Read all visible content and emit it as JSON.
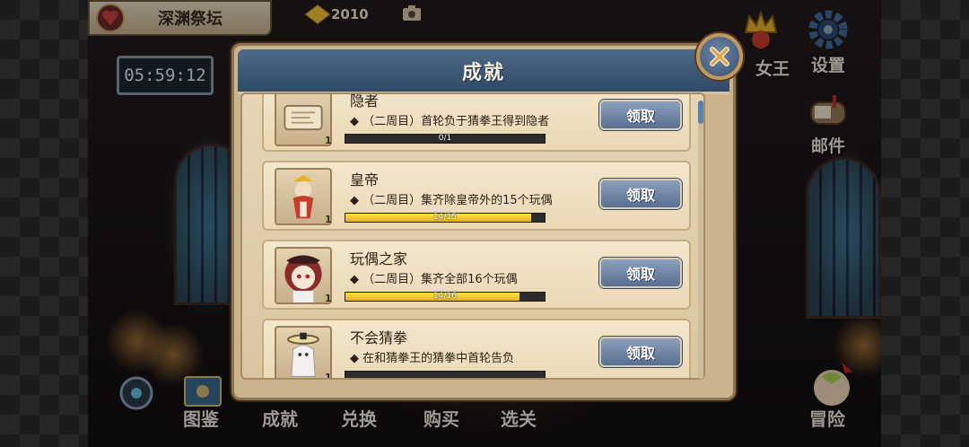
{
  "location": {
    "title": "深渊祭坛"
  },
  "timer": "05:59:12",
  "currency": {
    "amount": "2010",
    "color": "#f2c43a"
  },
  "side_menu": {
    "queen_label": "女王",
    "settings_label": "设置",
    "mail_label": "邮件"
  },
  "bottom_nav": {
    "catalog": "图鉴",
    "achievements": "成就",
    "exchange": "兑换",
    "shop": "购买",
    "levels": "选关",
    "adventure": "冒险"
  },
  "modal": {
    "title": "成就",
    "close_icon": "close-x-icon",
    "claim_label": "领取",
    "achievements": [
      {
        "title": "隐者",
        "desc": "◆ （二周目）首轮负于猜拳王得到隐者",
        "progress_text": "0/1",
        "progress": 0.0,
        "count": "1",
        "icon": "scroll-icon"
      },
      {
        "title": "皇帝",
        "desc": "◆ （二周目）集齐除皇帝外的15个玩偶",
        "progress_text": "14/15",
        "progress": 0.933,
        "count": "1",
        "icon": "emperor-doll-icon"
      },
      {
        "title": "玩偶之家",
        "desc": "◆ （二周目）集齐全部16个玩偶",
        "progress_text": "14/16",
        "progress": 0.875,
        "count": "1",
        "icon": "doll-girl-icon"
      },
      {
        "title": "不会猜拳",
        "desc": "◆ 在和猜拳王的猜拳中首轮告负",
        "progress_text": "",
        "progress": 0.0,
        "count": "1",
        "icon": "ghost-doll-icon"
      }
    ]
  },
  "colors": {
    "header": "#3f5a78",
    "progress_fill": "#f5c82a",
    "claim_button": "#6f84a2"
  }
}
